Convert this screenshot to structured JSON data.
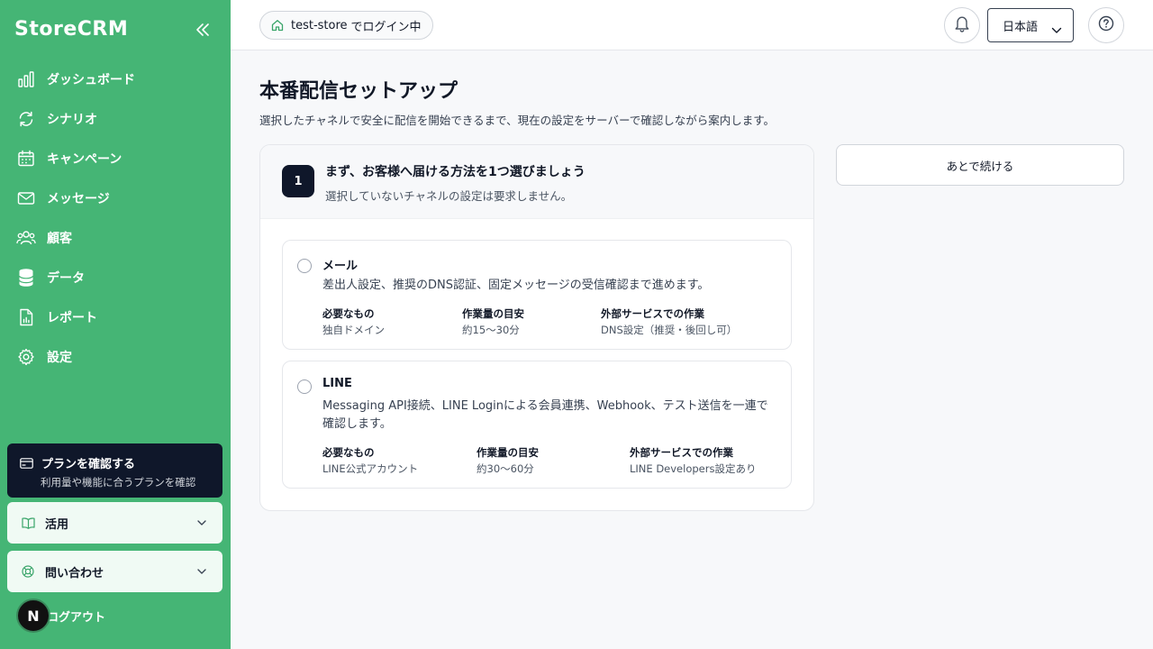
{
  "sidebar": {
    "brand": "StoreCRM",
    "items": [
      {
        "label": "ダッシュボード",
        "icon": "bar-chart-icon"
      },
      {
        "label": "シナリオ",
        "icon": "refresh-icon"
      },
      {
        "label": "キャンペーン",
        "icon": "calendar-icon"
      },
      {
        "label": "メッセージ",
        "icon": "mail-icon"
      },
      {
        "label": "顧客",
        "icon": "users-icon"
      },
      {
        "label": "データ",
        "icon": "database-icon"
      },
      {
        "label": "レポート",
        "icon": "file-chart-icon"
      },
      {
        "label": "設定",
        "icon": "gear-icon"
      }
    ],
    "plan": {
      "title": "プランを確認する",
      "subtitle": "利用量や機能に合うプランを確認"
    },
    "accordions": [
      {
        "label": "活用",
        "icon": "book-icon"
      },
      {
        "label": "問い合わせ",
        "icon": "lifebuoy-icon"
      }
    ],
    "avatar_letter": "N",
    "logout": "ログアウト"
  },
  "header": {
    "store_name": "test-store",
    "store_suffix": "でログイン中",
    "language": "日本語"
  },
  "main": {
    "title": "本番配信セットアップ",
    "description": "選択したチャネルで安全に配信を開始できるまで、現在の設定をサーバーで確認しながら案内します。",
    "step": {
      "number": "1",
      "title": "まず、お客様へ届ける方法を1つ選びましょう",
      "subtitle": "選択していないチャネルの設定は要求しません。"
    },
    "options": [
      {
        "title": "メール",
        "description": "差出人設定、推奨のDNS認証、固定メッセージの受信確認まで進めます。",
        "meta": [
          {
            "key": "必要なもの",
            "value": "独自ドメイン"
          },
          {
            "key": "作業量の目安",
            "value": "約15〜30分"
          },
          {
            "key": "外部サービスでの作業",
            "value": "DNS設定（推奨・後回し可）"
          }
        ]
      },
      {
        "title": "LINE",
        "description": "Messaging API接続、LINE Loginによる会員連携、Webhook、テスト送信を一連で確認します。",
        "meta": [
          {
            "key": "必要なもの",
            "value": "LINE公式アカウント"
          },
          {
            "key": "作業量の目安",
            "value": "約30〜60分"
          },
          {
            "key": "外部サービスでの作業",
            "value": "LINE Developers設定あり"
          }
        ]
      }
    ],
    "later_button": "あとで続ける"
  },
  "colors": {
    "sidebar": "#45b575",
    "dark": "#0f172a",
    "accent_icon": "#3aa56a"
  }
}
